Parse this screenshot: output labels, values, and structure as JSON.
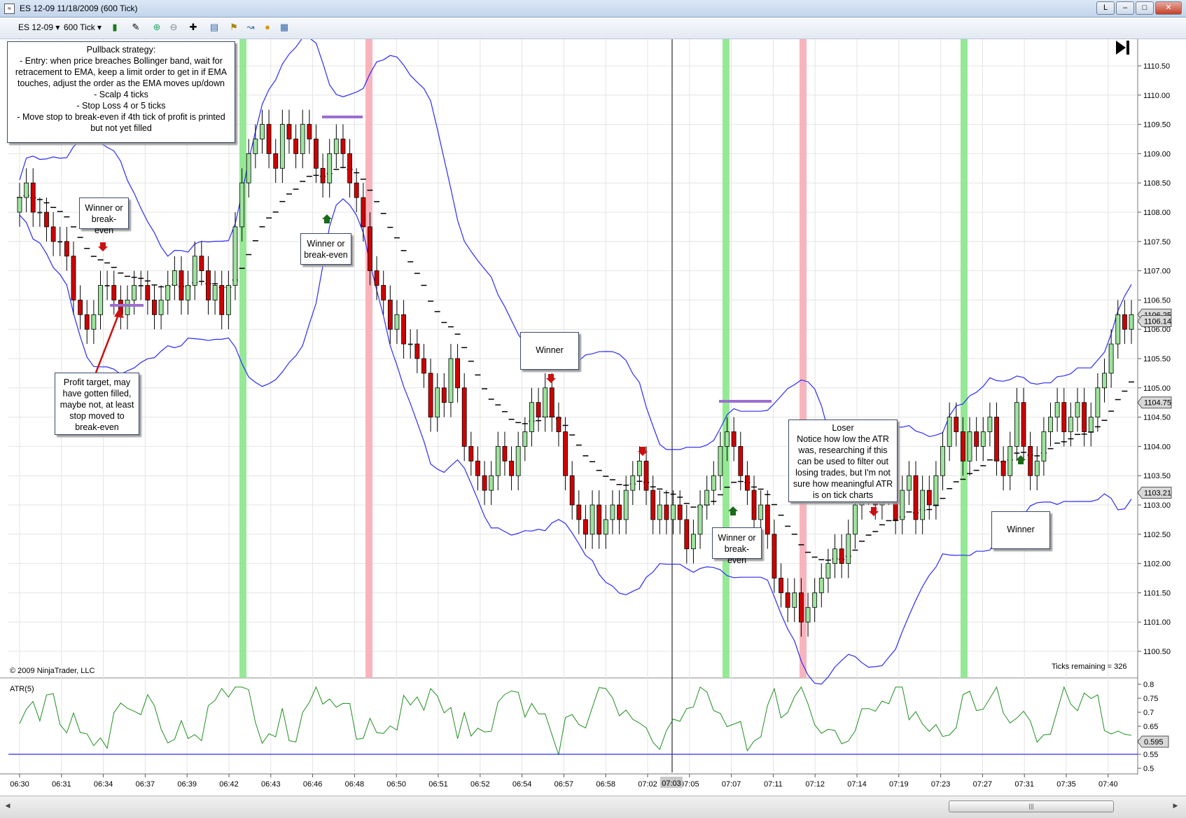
{
  "window": {
    "title": "ES 12-09  11/18/2009 (600 Tick)",
    "buttons": {
      "link": "L",
      "minimize": "–",
      "maximize": "□",
      "close": "✕"
    }
  },
  "toolbar": {
    "instrument": "ES 12-09",
    "interval": "600 Tick",
    "icons": [
      "bar-type-icon",
      "draw-tool-icon",
      "zoom-in-icon",
      "zoom-out-icon",
      "crosshair-icon",
      "properties-icon",
      "strategies-icon",
      "indicators-icon",
      "chart-trader-icon",
      "data-box-icon"
    ]
  },
  "chart": {
    "copyright": "© 2009 NinjaTrader, LLC",
    "ticks_remaining": "Ticks remaining = 326",
    "indicator_label": "ATR(5)",
    "price_axis": [
      "1110.50",
      "1110.00",
      "1109.50",
      "1109.00",
      "1108.50",
      "1108.00",
      "1107.50",
      "1107.00",
      "1106.50",
      "1106.00",
      "1105.50",
      "1105.00",
      "1104.50",
      "1104.00",
      "1103.50",
      "1103.00",
      "1102.50",
      "1102.00",
      "1101.50",
      "1101.00",
      "1100.50"
    ],
    "price_markers": [
      "1106.25",
      "1106.14",
      "1104.75",
      "1103.21"
    ],
    "atr_axis": [
      "0.8",
      "0.75",
      "0.7",
      "0.65",
      "0.6",
      "0.55",
      "0.5"
    ],
    "atr_marker": "0.595",
    "time_axis": [
      "06:30",
      "06:31",
      "06:34",
      "06:37",
      "06:39",
      "06:42",
      "06:43",
      "06:46",
      "06:48",
      "06:50",
      "06:51",
      "06:52",
      "06:54",
      "06:57",
      "06:58",
      "07:02",
      "07:05",
      "07:07",
      "07:11",
      "07:12",
      "07:14",
      "07:19",
      "07:23",
      "07:27",
      "07:31",
      "07:35",
      "07:40"
    ],
    "crosshair_time": "07:03",
    "colors": {
      "up_candle": "#9ee39e",
      "down_candle": "#d00000",
      "bollinger": "#2b2bff",
      "ema": "#000000",
      "atr_line": "#1f8f1f",
      "atr_threshold": "#2b2bff",
      "entry_long_bar": "#8fe88f",
      "entry_short_bar": "#f8b0b8",
      "target_line": "#9b6fd0"
    }
  },
  "annotations": {
    "strategy": [
      "Pullback strategy:",
      "- Entry: when price breaches Bollinger band, wait for",
      "retracement to EMA, keep a limit order to get in if EMA",
      "touches, adjust the order as the EMA moves up/down",
      "- Scalp 4 ticks",
      "- Stop Loss 4 or 5 ticks",
      "- Move stop to break-even if 4th tick of profit is printed",
      "but not yet filled"
    ],
    "note1": [
      "Winner or",
      "break-even"
    ],
    "note2": [
      "Winner or",
      "break-even"
    ],
    "note3": [
      "Winner"
    ],
    "note4": [
      "Profit target, may",
      "have gotten filled,",
      "maybe not, at least",
      "stop moved to",
      "break-even"
    ],
    "note5": [
      "Winner or",
      "break-even"
    ],
    "note6": [
      "Loser",
      "Notice how low the ATR",
      "was, researching if this",
      "can be used to filter out",
      "losing trades, but I'm not",
      "sure how meaningful ATR",
      "is on tick charts"
    ],
    "note7": [
      "Winner"
    ]
  }
}
